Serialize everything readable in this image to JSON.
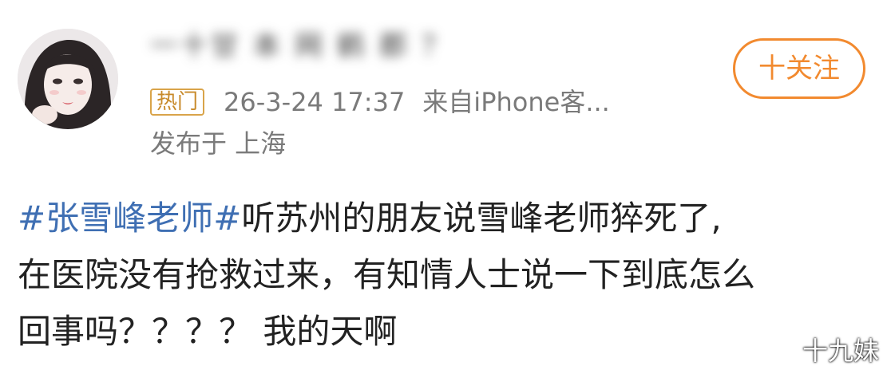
{
  "user": {
    "name": "一十甘 本 网 鹤 郡 ？",
    "badge": "热门",
    "date": "26-3-24 17:37",
    "source": "来自iPhone客...",
    "location": "发布于 上海"
  },
  "follow_button": {
    "label": "十关注"
  },
  "post": {
    "hashtag": "#张雪峰老师#",
    "line1_text": "听苏州的朋友说雪峰老师猝死了,",
    "line2": "在医院没有抢救过来，有知情人士说一下到底怎么",
    "line3": "回事吗？？？？ 我的天啊"
  },
  "watermark": "十九妹",
  "colors": {
    "accent": "#f28a2f",
    "hashtag": "#3f6fb3",
    "badge": "#d9a44a",
    "meta": "#7a7a7a"
  }
}
